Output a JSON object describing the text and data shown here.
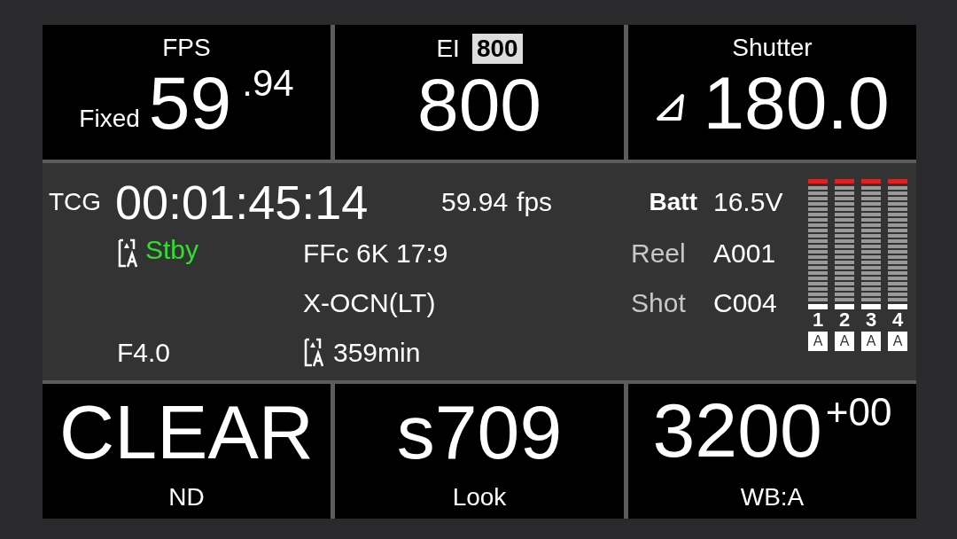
{
  "top_tiles": [
    {
      "kind": "fps",
      "label": "FPS",
      "prefix": "Fixed",
      "value": "59",
      "suffix": ".94"
    },
    {
      "kind": "ei",
      "label": "EI",
      "badge": "800",
      "value": "800"
    },
    {
      "kind": "shutter",
      "label": "Shutter",
      "value": "180.0"
    }
  ],
  "status": {
    "timecode": {
      "label": "TCG",
      "value": "00:01:45:14"
    },
    "frame_rate": {
      "value": "59.94",
      "unit": "fps"
    },
    "record_state": "Stby",
    "format": "FFc 6K 17:9",
    "codec": "X-OCN(LT)",
    "iris": "F4.0",
    "remaining": "359min",
    "battery": {
      "label": "Batt",
      "value": "16.5V"
    },
    "reel": {
      "label": "Reel",
      "value": "A001"
    },
    "shot": {
      "label": "Shot",
      "value": "C004"
    },
    "audio_channels": [
      {
        "number": "1",
        "input": "A"
      },
      {
        "number": "2",
        "input": "A"
      },
      {
        "number": "3",
        "input": "A"
      },
      {
        "number": "4",
        "input": "A"
      }
    ]
  },
  "bottom_tiles": [
    {
      "kind": "plain",
      "value": "CLEAR",
      "label": "ND"
    },
    {
      "kind": "plain",
      "value": "s709",
      "label": "Look"
    },
    {
      "kind": "offset",
      "value": "3200",
      "suffix": "+00",
      "label": "WB:A"
    }
  ]
}
